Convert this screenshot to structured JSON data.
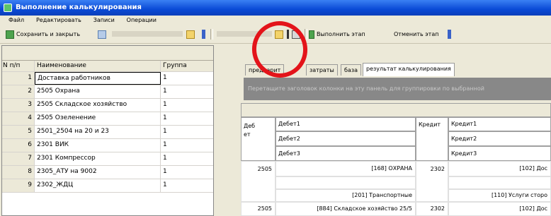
{
  "window": {
    "title": "Выполнение калькулирования"
  },
  "menu": [
    "Файл",
    "Редактировать",
    "Записи",
    "Операции"
  ],
  "toolbar": {
    "save_close": "Сохранить и закрыть",
    "run_stage": "Выполнить этап",
    "cancel_stage": "Отменить этап"
  },
  "left_table": {
    "columns": [
      "N п/п",
      "Наименование",
      "Группа"
    ],
    "rows": [
      {
        "n": "1",
        "name": "Доставка работников",
        "group": "1"
      },
      {
        "n": "2",
        "name": "2505 Охрана",
        "group": "1"
      },
      {
        "n": "3",
        "name": "2505 Складское хозяйство",
        "group": "1"
      },
      {
        "n": "4",
        "name": "2505 Озеленение",
        "group": "1"
      },
      {
        "n": "5",
        "name": "2501_2504 на 20 и 23",
        "group": "1"
      },
      {
        "n": "6",
        "name": "2301 ВИК",
        "group": "1"
      },
      {
        "n": "7",
        "name": "2301 Компрессор",
        "group": "1"
      },
      {
        "n": "8",
        "name": "2305_АТУ на 9002",
        "group": "1"
      },
      {
        "n": "9",
        "name": "2302_ЖДЦ",
        "group": "1"
      }
    ]
  },
  "tabs": [
    "предварит",
    "затраты",
    "база",
    "результат калькулирования"
  ],
  "grouping_hint": "Перетащите заголовок колонки на эту панель для группировки по выбранной",
  "grid": {
    "col_debit": "Деб ет",
    "col_debit_short": "Деб",
    "col_debit_tail": "ет",
    "debet1": "Дебет1",
    "debet2": "Дебет2",
    "debet3": "Дебет3",
    "col_credit": "Кредит",
    "credit1": "Кредит1",
    "credit2": "Кредит2",
    "credit3": "Кредит3",
    "rows": [
      {
        "debit": "2505",
        "d1": "[168] ОХРАНА",
        "credit": "2302",
        "c1": "[102] Дос"
      },
      {
        "d3": "[201] Транспортные",
        "c3": "[110] Услуги сторо"
      },
      {
        "debit": "2505",
        "d1": "[884] Складское хозяйство 25/5",
        "credit": "2302",
        "c1": "[102] Дос"
      }
    ]
  },
  "colors": {
    "titlebar": "#0a4ad6",
    "annotation": "#e3141a"
  }
}
